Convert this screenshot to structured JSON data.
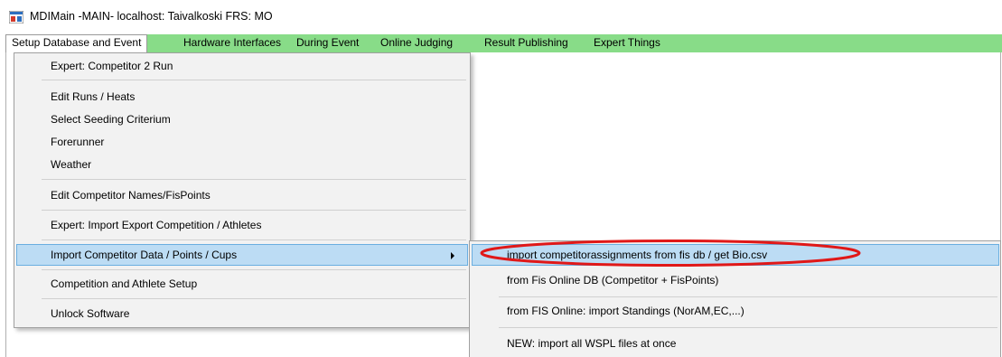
{
  "window": {
    "title": "MDIMain -MAIN- localhost: Taivalkoski FRS: MO",
    "icon": "app-window-icon"
  },
  "menubar": {
    "background": "#88dc88",
    "items": [
      {
        "label": "Setup Database and Event",
        "active": true
      },
      {
        "label": "Hardware Interfaces"
      },
      {
        "label": "During Event"
      },
      {
        "label": "Online Judging"
      },
      {
        "label": "Result Publishing"
      },
      {
        "label": "Expert Things"
      }
    ]
  },
  "setup_menu": {
    "items": [
      {
        "label": "Expert: Competitor 2 Run"
      },
      {
        "label": "Edit Runs / Heats"
      },
      {
        "label": "Select Seeding Criterium"
      },
      {
        "label": "Forerunner"
      },
      {
        "label": "Weather"
      },
      {
        "label": "Edit Competitor Names/FisPoints"
      },
      {
        "label": "Expert: Import Export Competition / Athletes"
      },
      {
        "label": "Import Competitor Data / Points / Cups",
        "highlighted": true,
        "has_submenu": true
      },
      {
        "label": "Competition and Athlete Setup"
      },
      {
        "label": "Unlock Software"
      }
    ]
  },
  "import_submenu": {
    "items": [
      {
        "label": "import competitorassignments from fis db / get Bio.csv",
        "highlighted": true,
        "annotated": true
      },
      {
        "label": "from Fis Online DB (Competitor + FisPoints)"
      },
      {
        "label": "from FIS Online: import Standings (NorAM,EC,...)"
      },
      {
        "label": "NEW: import all WSPL files at once"
      }
    ]
  },
  "colors": {
    "highlight": "#bcdcf4",
    "highlight_border": "#6aaee0",
    "annotation": "#e01818"
  }
}
